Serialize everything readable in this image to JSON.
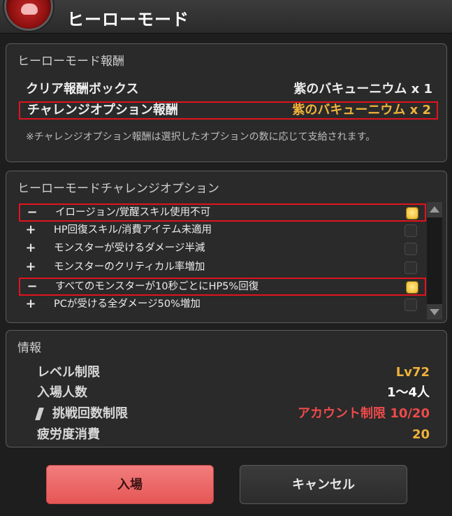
{
  "window": {
    "title": "ヒーローモード"
  },
  "rewards": {
    "title": "ヒーローモード報酬",
    "items": [
      {
        "label": "クリア報酬ボックス",
        "value": "紫のバキューニウム x 1"
      },
      {
        "label": "チャレンジオプション報酬",
        "value": "紫のバキューニウム x 2"
      }
    ],
    "note": "※チャレンジオプション報酬は選択したオプションの数に応じて支給されます。"
  },
  "options": {
    "title": "ヒーローモードチャレンジオプション",
    "items": [
      {
        "sign": "−",
        "text": "イロージョン/覚醒スキル使用不可",
        "checked": true
      },
      {
        "sign": "+",
        "text": "HP回復スキル/消費アイテム未適用",
        "checked": false
      },
      {
        "sign": "+",
        "text": "モンスターが受けるダメージ半減",
        "checked": false
      },
      {
        "sign": "+",
        "text": "モンスターのクリティカル率増加",
        "checked": false
      },
      {
        "sign": "−",
        "text": "すべてのモンスターが10秒ごとにHP5%回復",
        "checked": true
      },
      {
        "sign": "+",
        "text": "PCが受ける全ダメージ50%増加",
        "checked": false
      }
    ]
  },
  "info": {
    "title": "情報",
    "level": {
      "label": "レベル制限",
      "value": "Lv72"
    },
    "players": {
      "label": "入場人数",
      "value": "1～4人"
    },
    "attempts": {
      "label": "挑戦回数制限",
      "value": "アカウント制限  10/20"
    },
    "fatigue": {
      "label": "疲労度消費",
      "value": "20"
    }
  },
  "buttons": {
    "enter": "入場",
    "cancel": "キャンセル"
  },
  "colors": {
    "highlight_border": "#e0141e",
    "gold_value": "#f0b23a",
    "red_value": "#ee4a4a",
    "enter_button": "#e65656"
  }
}
